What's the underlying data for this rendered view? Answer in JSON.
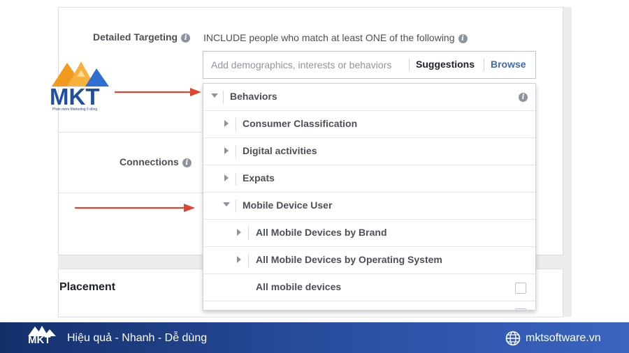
{
  "targeting": {
    "detailed_label": "Detailed Targeting",
    "include_text": "INCLUDE people who match at least ONE of the following",
    "search_placeholder": "Add demographics, interests or behaviors",
    "suggestions_label": "Suggestions",
    "browse_label": "Browse",
    "connections_label": "Connections",
    "placement_label": "Placement"
  },
  "dropdown": {
    "items": [
      {
        "label": "Behaviors",
        "state": "expanded",
        "level": 0,
        "trailing": "info-icon"
      },
      {
        "label": "Consumer Classification",
        "state": "collapsed",
        "level": 1
      },
      {
        "label": "Digital activities",
        "state": "collapsed",
        "level": 1
      },
      {
        "label": "Expats",
        "state": "collapsed",
        "level": 1
      },
      {
        "label": "Mobile Device User",
        "state": "expanded",
        "level": 1
      },
      {
        "label": "All Mobile Devices by Brand",
        "state": "collapsed",
        "level": 2
      },
      {
        "label": "All Mobile Devices by Operating System",
        "state": "collapsed",
        "level": 2
      },
      {
        "label": "All mobile devices",
        "state": "leaf",
        "level": 2,
        "trailing": "checkbox",
        "checked": false
      }
    ]
  },
  "watermark": {
    "logo_text": "MKT",
    "tagline": "Phần mềm Marketing 0 đồng"
  },
  "footer": {
    "logo_text": "MKT",
    "slogan": "Hiệu quả - Nhanh - Dễ dùng",
    "website": "mktsoftware.vn"
  },
  "colors": {
    "accent_blue": "#4267b2",
    "arrow_red": "#e0442f",
    "footer_dark": "#14306b",
    "footer_light": "#3a64c0",
    "logo_orange": "#f29a1f",
    "logo_blue": "#1f4f9e"
  }
}
